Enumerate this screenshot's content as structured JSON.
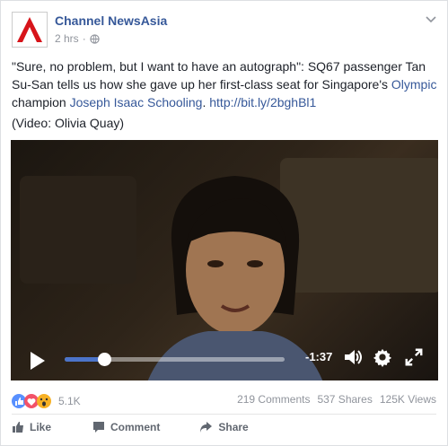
{
  "post": {
    "page_name": "Channel NewsAsia",
    "timestamp": "2 hrs",
    "separator": "·",
    "body_part1": "\"Sure, no problem, but I want to have an autograph\": SQ67 passenger Tan Su-San tells us how she gave up her first-class seat for Singapore's ",
    "body_link1": "Olympic",
    "body_part2": " champion ",
    "body_link2": "Joseph Isaac Schooling",
    "body_part3": ". ",
    "body_link3": "http://bit.ly/2bghBl1",
    "caption": "(Video: Olivia Quay)"
  },
  "video": {
    "time_remaining": "-1:37",
    "progress": 0.18
  },
  "stats": {
    "reactions": "5.1K",
    "comments": "219 Comments",
    "shares": "537 Shares",
    "views": "125K Views"
  },
  "actions": {
    "like": "Like",
    "comment": "Comment",
    "share": "Share"
  },
  "colors": {
    "link": "#365899",
    "progress": "#4c74c9",
    "logo_red": "#d7141a"
  }
}
